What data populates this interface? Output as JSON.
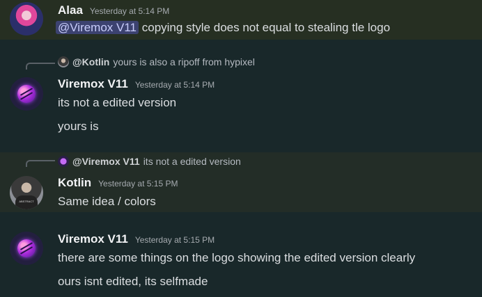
{
  "messages": [
    {
      "author": "Alaa",
      "timestamp": "Yesterday at 5:14 PM",
      "mention": "@Viremox V11",
      "text_after_mention": " copying style does not equal to stealing tle logo"
    },
    {
      "reply_to_name": "@Kotlin",
      "reply_to_text": "yours is also a ripoff from hypixel",
      "author": "Viremox V11",
      "timestamp": "Yesterday at 5:14 PM",
      "lines": [
        "its not a edited version",
        "yours is"
      ]
    },
    {
      "reply_to_name": "@Viremox V11",
      "reply_to_text": "its not a edited version",
      "author": "Kotlin",
      "timestamp": "Yesterday at 5:15 PM",
      "lines": [
        "Same idea / colors"
      ]
    },
    {
      "author": "Viremox V11",
      "timestamp": "Yesterday at 5:15 PM",
      "lines": [
        "there are some things on the logo showing the edited version clearly",
        "ours isnt edited, its selfmade"
      ]
    }
  ],
  "colors": {
    "highlight_bg": "#262f22",
    "channel_bg": "#1c2a2b",
    "mention_bg": "#3c4270",
    "mention_fg": "#c9cdfb"
  }
}
